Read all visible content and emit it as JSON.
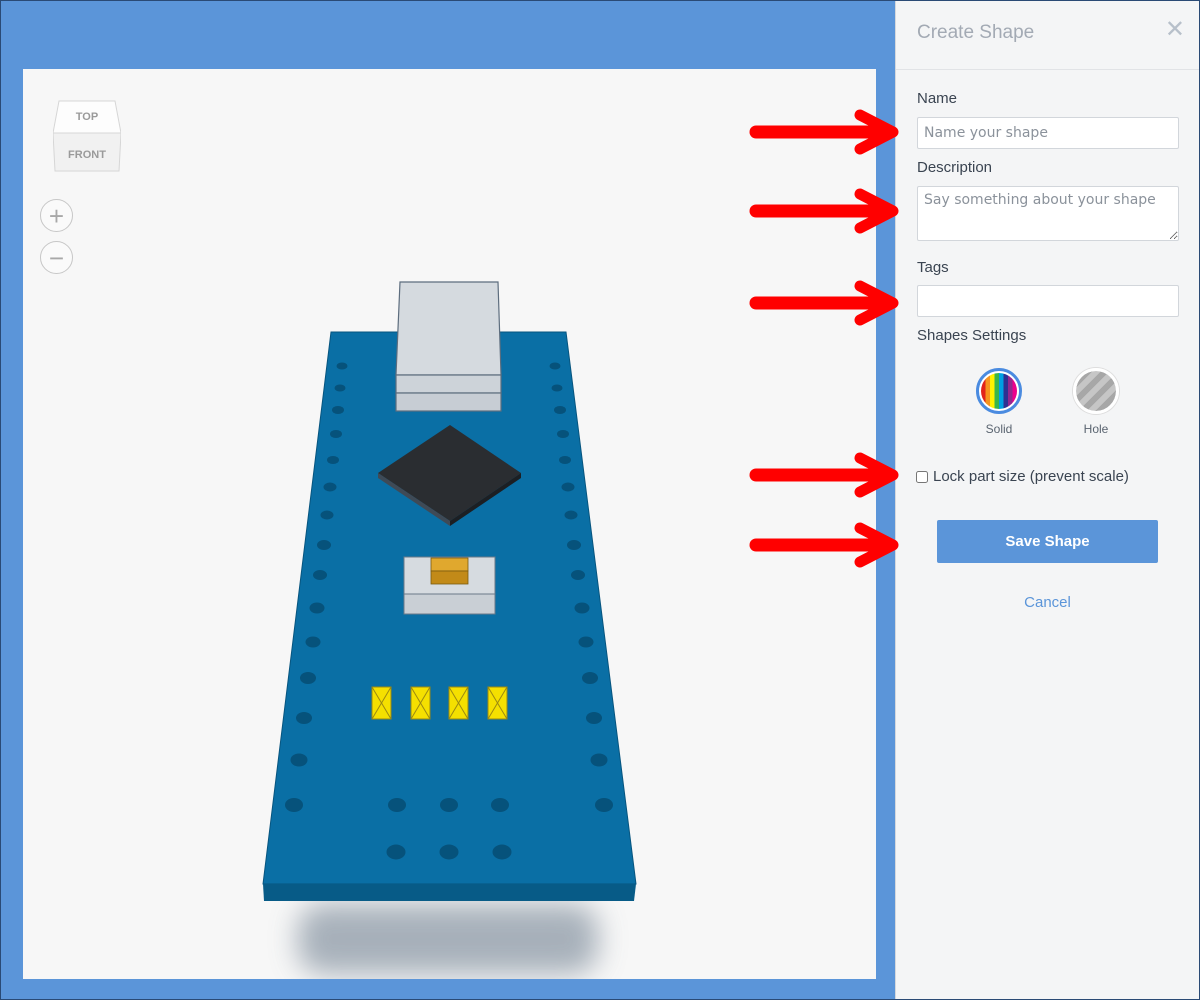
{
  "viewcube": {
    "top_label": "TOP",
    "front_label": "FRONT"
  },
  "zoom": {
    "in_symbol": "+",
    "out_symbol": "−"
  },
  "panel": {
    "title": "Create Shape",
    "close_symbol": "✕",
    "name": {
      "label": "Name",
      "placeholder": "Name your shape",
      "value": ""
    },
    "description": {
      "label": "Description",
      "placeholder": "Say something about your shape",
      "value": ""
    },
    "tags": {
      "label": "Tags",
      "value": ""
    },
    "settings": {
      "label": "Shapes Settings",
      "options": [
        {
          "label": "Solid",
          "selected": true
        },
        {
          "label": "Hole",
          "selected": false
        }
      ]
    },
    "lock": {
      "label": "Lock part size (prevent scale)",
      "checked": false
    },
    "save_label": "Save Shape",
    "cancel_label": "Cancel"
  },
  "colors": {
    "accent": "#5b95d9",
    "board": "#0a6fa5",
    "arrow": "#ff0000"
  }
}
